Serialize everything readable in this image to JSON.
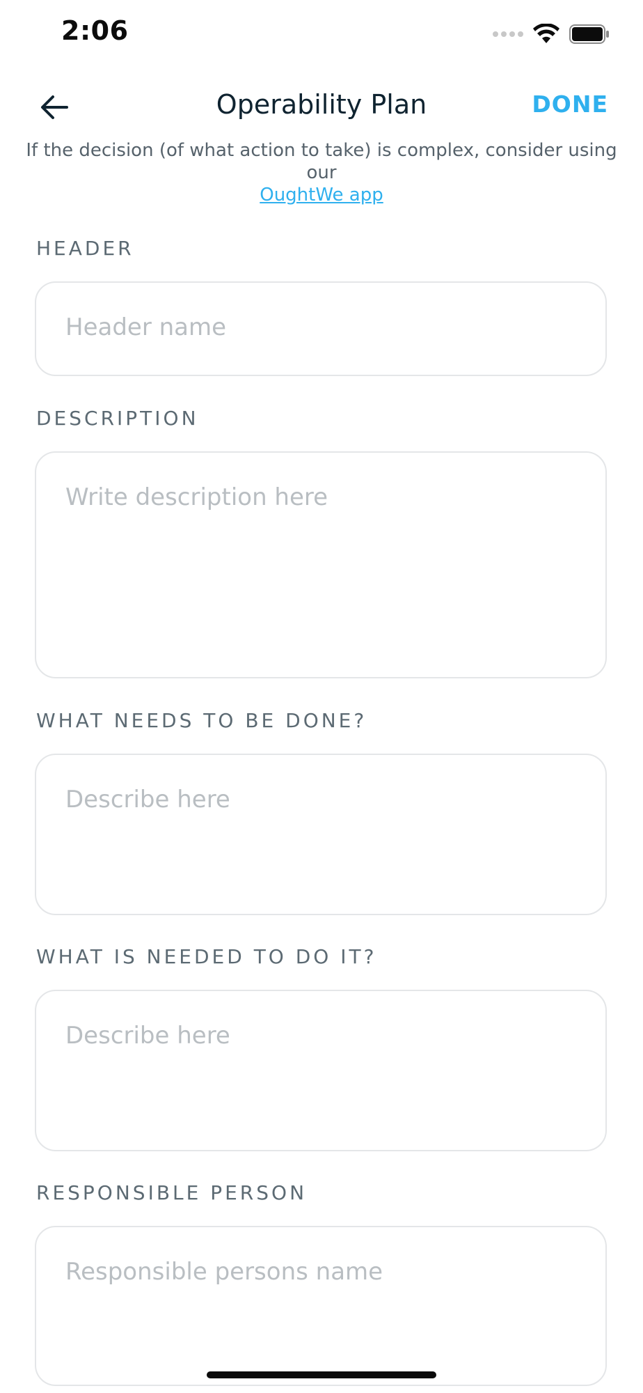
{
  "status_bar": {
    "time": "2:06",
    "icons": [
      "signal-dots-icon",
      "wifi-icon",
      "battery-icon"
    ]
  },
  "nav": {
    "back_icon": "arrow-left-icon",
    "title": "Operability Plan",
    "done_label": "DONE"
  },
  "hint": {
    "text": "If the decision (of what action to take) is complex, consider using our",
    "link_text": "OughtWe app"
  },
  "form": {
    "header": {
      "label": "HEADER",
      "placeholder": "Header name",
      "value": ""
    },
    "description": {
      "label": "DESCRIPTION",
      "placeholder": "Write description here",
      "value": ""
    },
    "what_needs": {
      "label": "WHAT NEEDS TO BE DONE?",
      "placeholder": "Describe here",
      "value": ""
    },
    "what_needed": {
      "label": "WHAT IS NEEDED TO DO IT?",
      "placeholder": "Describe here",
      "value": ""
    },
    "responsible": {
      "label": "RESPONSIBLE PERSON",
      "placeholder": "Responsible persons name",
      "value": ""
    }
  },
  "colors": {
    "accent": "#2fb0ee",
    "label": "#5c6a73",
    "placeholder": "#b9bec2",
    "border": "#e4e6e8"
  }
}
